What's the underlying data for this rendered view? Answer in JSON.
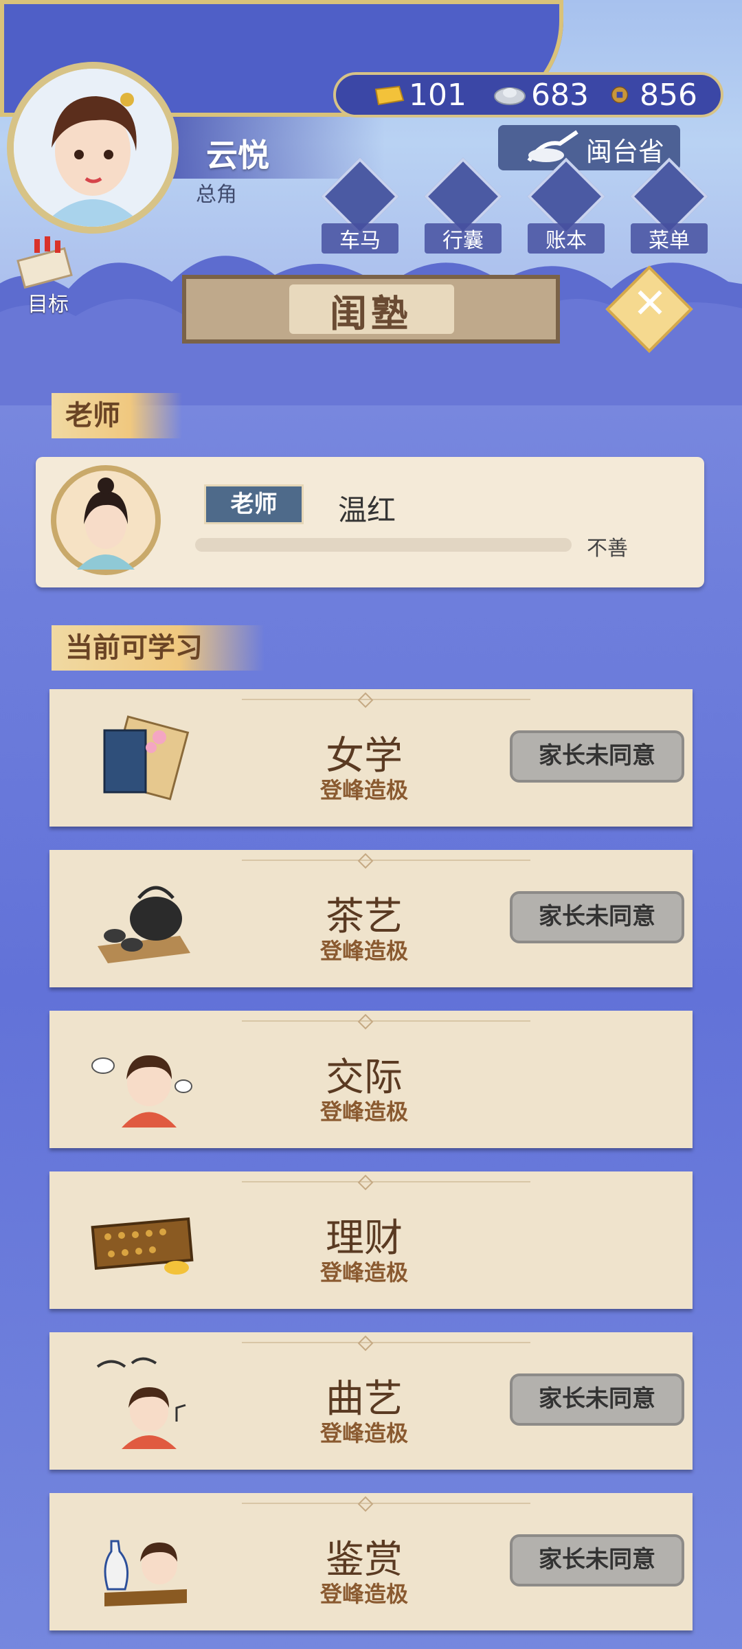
{
  "header": {
    "player_name": "云悦",
    "player_role": "总角",
    "currency": {
      "gold": "101",
      "silver": "683",
      "coin": "856"
    },
    "location": "闽台省",
    "menu": [
      "车马",
      "行囊",
      "账本",
      "菜单"
    ],
    "goal_label": "目标"
  },
  "page": {
    "title": "闺塾",
    "close_symbol": "✕"
  },
  "teacher_section": {
    "title": "老师",
    "badge": "老师",
    "name": "温红",
    "relation": "不善"
  },
  "skills_section": {
    "title": "当前可学习",
    "items": [
      {
        "name": "女学",
        "level": "登峰造极",
        "action": "家长未同意"
      },
      {
        "name": "茶艺",
        "level": "登峰造极",
        "action": "家长未同意"
      },
      {
        "name": "交际",
        "level": "登峰造极",
        "action": ""
      },
      {
        "name": "理财",
        "level": "登峰造极",
        "action": ""
      },
      {
        "name": "曲艺",
        "level": "登峰造极",
        "action": "家长未同意"
      },
      {
        "name": "鉴赏",
        "level": "登峰造极",
        "action": "家长未同意"
      }
    ]
  },
  "colors": {
    "background": "#6f7fdc",
    "card": "#efe3cc",
    "accent_gold": "#d7c387",
    "text_brown": "#5a3a22"
  }
}
